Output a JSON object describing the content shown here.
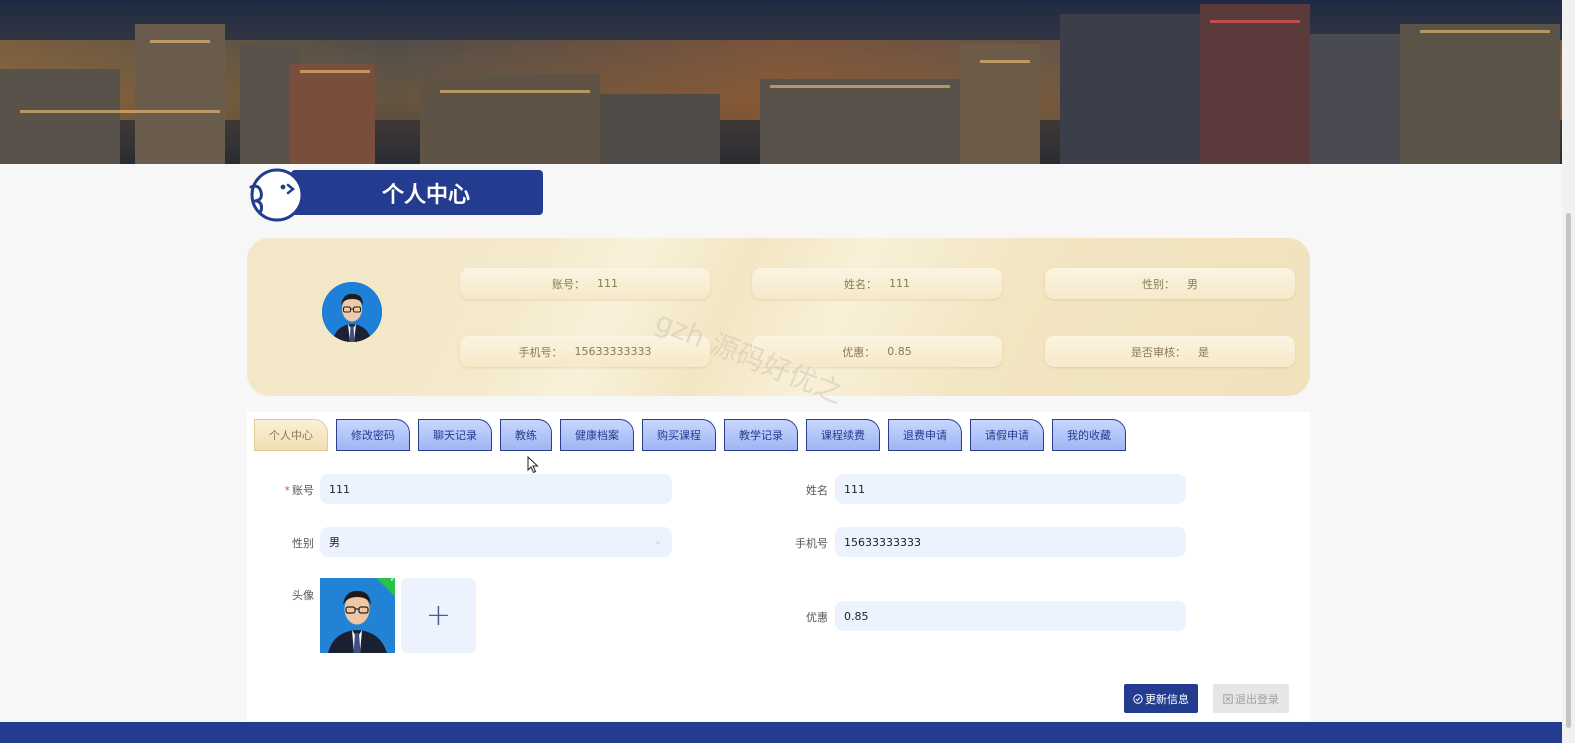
{
  "page": {
    "section_title": "个人中心",
    "watermark": "gzh 源码好优之"
  },
  "profile_summary": {
    "fields": [
      {
        "label": "账号：",
        "value": "111"
      },
      {
        "label": "姓名：",
        "value": "111"
      },
      {
        "label": "性别：",
        "value": "男"
      },
      {
        "label": "手机号：",
        "value": "15633333333"
      },
      {
        "label": "优惠：",
        "value": "0.85"
      },
      {
        "label": "是否审核：",
        "value": "是"
      }
    ]
  },
  "tabs": [
    {
      "label": "个人中心",
      "active": true
    },
    {
      "label": "修改密码"
    },
    {
      "label": "聊天记录"
    },
    {
      "label": "教练"
    },
    {
      "label": "健康档案"
    },
    {
      "label": "购买课程"
    },
    {
      "label": "教学记录"
    },
    {
      "label": "课程续费"
    },
    {
      "label": "退费申请"
    },
    {
      "label": "请假申请"
    },
    {
      "label": "我的收藏"
    }
  ],
  "form": {
    "account_label": "账号",
    "account_value": "111",
    "name_label": "姓名",
    "name_value": "111",
    "gender_label": "性别",
    "gender_value": "男",
    "phone_label": "手机号",
    "phone_value": "15633333333",
    "avatar_label": "头像",
    "discount_label": "优惠",
    "discount_value": "0.85",
    "upload_symbol": "+"
  },
  "actions": {
    "update_label": "更新信息",
    "logout_label": "退出登录"
  },
  "colors": {
    "primary": "#233c8f",
    "card_gold": "#f2e5c1",
    "input_bg": "#edf3fe",
    "required": "#e94b4b",
    "success": "#27c24c"
  },
  "icons": {
    "title": "cartoon-face-icon",
    "update": "check-circle-icon",
    "logout": "close-square-icon",
    "select": "chevron-down-icon",
    "upload": "plus-icon"
  }
}
